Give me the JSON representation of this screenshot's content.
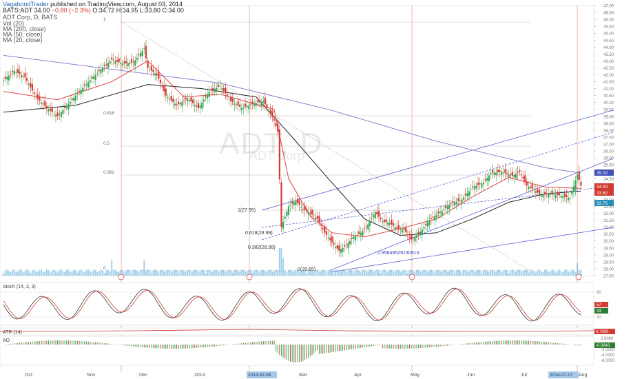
{
  "header": {
    "publisher": "VagabondTrader",
    "published_text": "published on TradingView.com, August 03, 2014",
    "symbol_line": "BATS:ADT  34.00",
    "change": "−0.80 (−2.3%)",
    "ohlc": "O:34.72 H:34.95 L:33.80 C:34.00",
    "title_line": "ADT Corp, D, BATS",
    "legend": [
      "Vol (20)",
      "MA (200, close)",
      "MA (50, close)",
      "MA (20, close)"
    ]
  },
  "watermark": {
    "symbol": "ADT, D",
    "name": "ADT Corp"
  },
  "chart_data": {
    "type": "candlestick",
    "symbol": "ADT",
    "interval": "D",
    "y_ticks": [
      "47.00",
      "46.50",
      "46.00",
      "45.50",
      "45.00",
      "44.50",
      "44.00",
      "43.50",
      "43.00",
      "42.50",
      "42.00",
      "41.50",
      "41.00",
      "40.50",
      "40.00",
      "39.50",
      "39.00",
      "38.50",
      "38.00",
      "37.50",
      "37.00",
      "36.50",
      "36.00",
      "35.50",
      "35.00",
      "34.50",
      "34.00",
      "33.50",
      "33.00",
      "32.50",
      "32.00",
      "31.50",
      "31.00",
      "30.50",
      "30.00",
      "29.50",
      "29.00",
      "28.50",
      "28.00",
      "27.50"
    ],
    "ylim": [
      27.5,
      47.0
    ],
    "x_ticks": [
      "Oct",
      "Nov",
      "Dec",
      "2014",
      "Feb",
      "Mar",
      "Apr",
      "May",
      "Jun",
      "Jul",
      "Aug"
    ],
    "x_highlights": [
      "2014-02-06",
      "2014-07-17"
    ],
    "price_badges": [
      {
        "label": "35.02",
        "color": "#3f51b5"
      },
      {
        "label": "34.00",
        "color": "#d23b32"
      },
      {
        "label": "33.62",
        "color": "#d23b32"
      },
      {
        "label": "32.75",
        "color": "#2a8fb5"
      }
    ],
    "fib_labels": [
      "1",
      "0.618",
      "0.5",
      "0.382",
      "0"
    ],
    "lower_fib_labels": [
      "1(27.95)",
      "0.618(28.99)",
      "0.382(28.99)",
      "0(29.65)"
    ],
    "annotation": "0.95649529130913",
    "close_path": [
      [
        0,
        41.6
      ],
      [
        6,
        42.3
      ],
      [
        12,
        41.8
      ],
      [
        18,
        40.4
      ],
      [
        24,
        39.6
      ],
      [
        30,
        39.0
      ],
      [
        36,
        39.9
      ],
      [
        42,
        40.8
      ],
      [
        48,
        41.6
      ],
      [
        54,
        42.4
      ],
      [
        60,
        43.1
      ],
      [
        66,
        42.8
      ],
      [
        72,
        42.9
      ],
      [
        78,
        43.9
      ],
      [
        80,
        42.5
      ],
      [
        85,
        42.0
      ],
      [
        90,
        40.5
      ],
      [
        96,
        39.8
      ],
      [
        102,
        40.3
      ],
      [
        108,
        39.6
      ],
      [
        114,
        40.8
      ],
      [
        120,
        41.2
      ],
      [
        126,
        40.1
      ],
      [
        132,
        39.6
      ],
      [
        138,
        39.9
      ],
      [
        144,
        40.1
      ],
      [
        150,
        38.7
      ],
      [
        152,
        37.9
      ],
      [
        154,
        31.0
      ],
      [
        158,
        32.5
      ],
      [
        162,
        32.9
      ],
      [
        166,
        32.3
      ],
      [
        170,
        32.0
      ],
      [
        174,
        31.6
      ],
      [
        178,
        30.6
      ],
      [
        182,
        29.9
      ],
      [
        186,
        29.3
      ],
      [
        190,
        29.7
      ],
      [
        194,
        30.3
      ],
      [
        198,
        30.6
      ],
      [
        202,
        31.2
      ],
      [
        206,
        32.1
      ],
      [
        210,
        31.4
      ],
      [
        214,
        31.3
      ],
      [
        218,
        30.9
      ],
      [
        222,
        30.8
      ],
      [
        226,
        30.1
      ],
      [
        230,
        30.5
      ],
      [
        236,
        31.5
      ],
      [
        242,
        32.1
      ],
      [
        248,
        32.7
      ],
      [
        254,
        33.0
      ],
      [
        260,
        33.9
      ],
      [
        266,
        34.2
      ],
      [
        270,
        34.9
      ],
      [
        276,
        35.0
      ],
      [
        282,
        34.7
      ],
      [
        286,
        35.0
      ],
      [
        290,
        34.0
      ],
      [
        294,
        33.7
      ],
      [
        298,
        33.3
      ],
      [
        302,
        33.4
      ],
      [
        308,
        33.3
      ],
      [
        314,
        33.1
      ],
      [
        318,
        34.8
      ],
      [
        320,
        34.0
      ]
    ],
    "ma20": [
      [
        0,
        40.8
      ],
      [
        30,
        40.2
      ],
      [
        60,
        41.5
      ],
      [
        80,
        43.0
      ],
      [
        100,
        40.4
      ],
      [
        120,
        40.6
      ],
      [
        150,
        39.5
      ],
      [
        158,
        34.5
      ],
      [
        170,
        31.8
      ],
      [
        182,
        30.6
      ],
      [
        200,
        30.3
      ],
      [
        220,
        30.9
      ],
      [
        240,
        31.6
      ],
      [
        260,
        33.2
      ],
      [
        280,
        34.6
      ],
      [
        300,
        33.9
      ],
      [
        320,
        33.8
      ]
    ],
    "ma50": [
      [
        0,
        39.3
      ],
      [
        40,
        39.8
      ],
      [
        80,
        41.3
      ],
      [
        110,
        41.0
      ],
      [
        140,
        40.4
      ],
      [
        160,
        37.5
      ],
      [
        180,
        34.5
      ],
      [
        200,
        31.6
      ],
      [
        220,
        30.4
      ],
      [
        240,
        30.6
      ],
      [
        260,
        31.6
      ],
      [
        280,
        32.8
      ],
      [
        300,
        33.4
      ],
      [
        320,
        33.6
      ]
    ],
    "ma200": [
      [
        0,
        43.4
      ],
      [
        60,
        42.4
      ],
      [
        120,
        41.4
      ],
      [
        180,
        39.5
      ],
      [
        240,
        37.2
      ],
      [
        300,
        35.3
      ],
      [
        320,
        34.9
      ]
    ],
    "volume_note": "Vol (20)",
    "oscillators": [
      {
        "name": "Stoch (14, 3, 3)",
        "levels": [
          "80",
          "20"
        ],
        "current": [
          "57",
          "43"
        ]
      },
      {
        "name": "ATR (14)",
        "current": "0.7000"
      },
      {
        "name": "AO",
        "levels": [
          "2.0000",
          "0.0000",
          "-2.0000",
          "-4.0000",
          "-6.0000"
        ],
        "current": "-0.0843"
      }
    ],
    "grid": false
  },
  "colors": {
    "up": "#34a853",
    "down": "#d23b32",
    "ma20": "#e04040",
    "ma50": "#222222",
    "ma200": "#8a7fd0",
    "channel": "#5b5bd6",
    "vline": "#e59a7a"
  }
}
